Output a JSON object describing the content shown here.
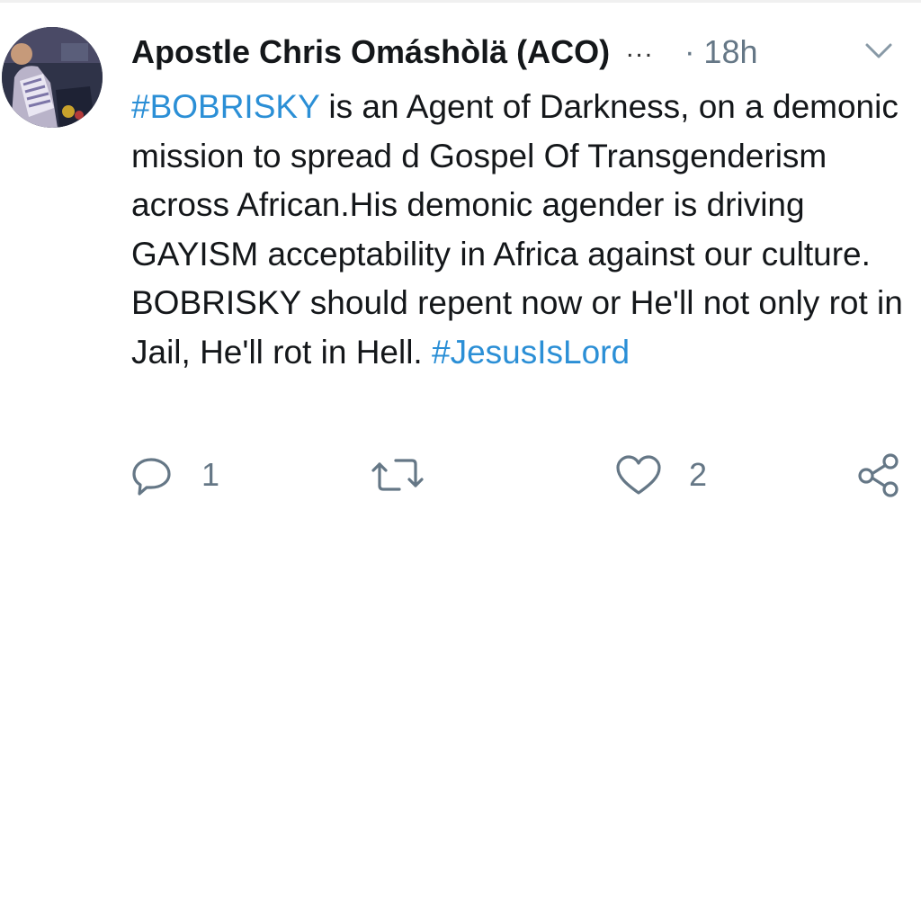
{
  "tweet": {
    "author": {
      "display_name": "Apostle Chris Omáshòlä (ACO)",
      "truncation": "...",
      "avatar_icon": "profile-photo"
    },
    "separator": "·",
    "timestamp": "18h",
    "body": {
      "hashtag_1": "#BOBRISKY",
      "text": " is an Agent of Darkness, on a demonic mission to spread d Gospel Of Transgenderism across African.His demonic agender is driving GAYISM acceptability in Africa against our culture. BOBRISKY should repent now or He'll not only rot in Jail, He'll rot in Hell. ",
      "hashtag_2": "#JesusIsLord"
    },
    "actions": {
      "reply_count": "1",
      "retweet_count": "",
      "like_count": "2"
    },
    "colors": {
      "hashtag": "#2b8fd6",
      "secondary_text": "#657786",
      "primary_text": "#14171a"
    }
  }
}
